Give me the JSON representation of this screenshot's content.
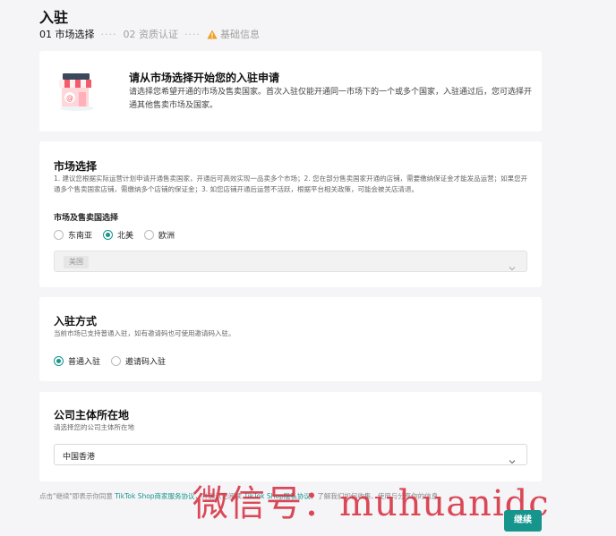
{
  "page": {
    "title": "入驻"
  },
  "steps": [
    {
      "label": "01 市场选择",
      "state": "active"
    },
    {
      "label": "02 资质认证",
      "state": "idle"
    },
    {
      "label": "基础信息",
      "state": "warning"
    }
  ],
  "step_separator": "····",
  "intro": {
    "title": "请从市场选择开始您的入驻申请",
    "description": "请选择您希望开通的市场及售卖国家。首次入驻仅能开通同一市场下的一个或多个国家，入驻通过后，您可选择开通其他售卖市场及国家。"
  },
  "market": {
    "title": "市场选择",
    "description": "1. 建议您根据实际运营计划申请开通售卖国家，开通后可高效实现一品卖多个市场；2. 您在部分售卖国家开通的店铺，需要缴纳保证金才能发品运营；如果您开通多个售卖国家店铺，需缴纳多个店铺的保证金；3. 如您店铺开通后运营不活跃，根据平台相关政策，可能会被关店清退。",
    "subtitle": "市场及售卖国选择",
    "options": [
      {
        "label": "东南亚",
        "selected": false
      },
      {
        "label": "北美",
        "selected": true
      },
      {
        "label": "欧洲",
        "selected": false
      }
    ],
    "country_tag": "美国"
  },
  "entry": {
    "title": "入驻方式",
    "description": "当前市场已支持普通入驻，如有邀请码也可使用邀请码入驻。",
    "options": [
      {
        "label": "普通入驻",
        "selected": true
      },
      {
        "label": "邀请码入驻",
        "selected": false
      }
    ]
  },
  "company": {
    "title": "公司主体所在地",
    "description": "请选择您的公司主体所在地",
    "value": "中国香港"
  },
  "footer": {
    "prefix": "点击\"继续\"即表示你同意 ",
    "link1": "TikTok Shop商家服务协议",
    "middle": "，并确认已阅读 ",
    "link2": "TikTok Shop隐私协议",
    "suffix": "，了解我们如何收集、使用与分享你的信息。"
  },
  "watermark": "微信号：muhuanidc",
  "continue_label": "继续",
  "colors": {
    "accent": "#16958c",
    "warning": "#f0a020",
    "watermark": "#d63042"
  }
}
